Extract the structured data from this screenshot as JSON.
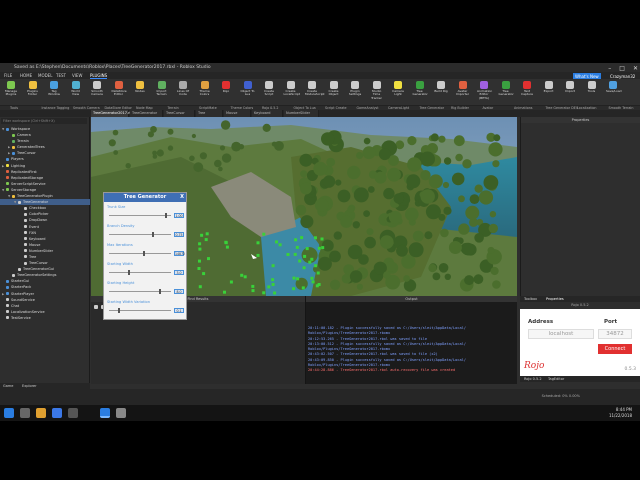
{
  "window": {
    "title": "Saved as E:\\Stephen\\Documents\\Roblox\\Places\\TreeGenerator2017.rbxl - Roblox Studio",
    "center_title": "TreeGenerator2017.rbxl - Roblox Studio"
  },
  "menubar": {
    "items": [
      "FILE",
      "HOME",
      "MODEL",
      "TEST",
      "VIEW",
      "PLUGINS"
    ],
    "active": "PLUGINS",
    "account_button": "What's New",
    "user": "Crazyman32"
  },
  "ribbon": {
    "buttons": [
      {
        "label": "Manage Plugins",
        "icon": "puzzle-icon",
        "color": "#7ec850"
      },
      {
        "label": "Plugins Folder",
        "icon": "folder-icon",
        "color": "#f0c040"
      },
      {
        "label": "Tag Window",
        "icon": "tag-icon",
        "color": "#4aa0e0"
      },
      {
        "label": "World View",
        "icon": "globe-icon",
        "color": "#50b0d0"
      },
      {
        "label": "Smooth Camera",
        "icon": "camera-icon",
        "color": "#cccccc"
      },
      {
        "label": "DataStore Editor",
        "icon": "database-icon",
        "color": "#e06040"
      },
      {
        "label": "Nodes",
        "icon": "nodes-icon",
        "color": "#f0c040"
      },
      {
        "label": "Import Terrain",
        "icon": "terrain-icon",
        "color": "#60b060"
      },
      {
        "label": "Lines Of Code",
        "icon": "code-icon",
        "color": "#aaaaaa"
      },
      {
        "label": "Theme Colors",
        "icon": "palette-icon",
        "color": "#e0a040"
      },
      {
        "label": "Rojo",
        "icon": "rojo-icon",
        "color": "#e13030"
      },
      {
        "label": "Object To Lua",
        "icon": "lua-icon",
        "color": "#4060d0"
      },
      {
        "label": "Create Script",
        "icon": "script-icon",
        "color": "#cccccc"
      },
      {
        "label": "Create LocalScript",
        "icon": "localscript-icon",
        "color": "#cccccc"
      },
      {
        "label": "Create ModuleScript",
        "icon": "modulescript-icon",
        "color": "#cccccc"
      },
      {
        "label": "Create Object",
        "icon": "object-icon",
        "color": "#cccccc"
      },
      {
        "label": "Plugin Settings",
        "icon": "settings-icon",
        "color": "#cccccc"
      },
      {
        "label": "Studio Time Tracker",
        "icon": "clock-icon",
        "color": "#cccccc"
      },
      {
        "label": "Camera Light",
        "icon": "bulb-icon",
        "color": "#f0e040"
      },
      {
        "label": "Tree Generator",
        "icon": "tree-icon",
        "color": "#3aa040"
      },
      {
        "label": "Build Rig",
        "icon": "rig-icon",
        "color": "#cccccc"
      },
      {
        "label": "Avatar Importer",
        "icon": "avatar-icon",
        "color": "#e06040"
      },
      {
        "label": "Animation Editor (BETA)",
        "icon": "animation-icon",
        "color": "#a060e0"
      },
      {
        "label": "Tree Generator",
        "icon": "tree-icon",
        "color": "#3aa040"
      },
      {
        "label": "Text Capture",
        "icon": "capture-icon",
        "color": "#e13030"
      },
      {
        "label": "Export",
        "icon": "export-icon",
        "color": "#cccccc"
      },
      {
        "label": "Import",
        "icon": "import-icon",
        "color": "#cccccc"
      },
      {
        "label": "Tools",
        "icon": "tools-icon",
        "color": "#cccccc"
      },
      {
        "label": "Save/Load",
        "icon": "save-icon",
        "color": "#50a0e0"
      }
    ],
    "groups": [
      "Tools",
      "Instance Tagging",
      "Smooth Camera",
      "DataStore Editor",
      "Node Map",
      "Terrain",
      "ScriptMate",
      "Theme Colors",
      "Rojo 0.5.2",
      "Object To Lua",
      "Script Create",
      "GameAnalyst",
      "CameraLight",
      "Tree Generator",
      "Rig Builder",
      "Avatar",
      "Animations",
      "Tree Generator DEV",
      "Localization",
      "Smooth Terrain"
    ]
  },
  "doc_tabs": [
    {
      "label": "TreeGenerator2017.rbxl",
      "active": true
    },
    {
      "label": "TreeGenerator",
      "active": false
    },
    {
      "label": "TreeCursor",
      "active": false
    },
    {
      "label": "Tree",
      "active": false
    },
    {
      "label": "Mouse",
      "active": false
    },
    {
      "label": "Keyboard",
      "active": false
    },
    {
      "label": "NumberSlider",
      "active": false
    }
  ],
  "explorer": {
    "header": "Explorer",
    "filter_placeholder": "Filter workspace (Ctrl+Shift+X)",
    "nodes": [
      {
        "label": "Workspace",
        "indent": 0,
        "arrow": "▼",
        "color": "#4a90d9"
      },
      {
        "label": "Camera",
        "indent": 1,
        "arrow": "",
        "color": "#7ec850"
      },
      {
        "label": "Terrain",
        "indent": 1,
        "arrow": "",
        "color": "#60b060"
      },
      {
        "label": "GeneratedTrees",
        "indent": 1,
        "arrow": "▶",
        "color": "#f0c040"
      },
      {
        "label": "TreeCursor",
        "indent": 1,
        "arrow": "▶",
        "color": "#4a90d9"
      },
      {
        "label": "Players",
        "indent": 0,
        "arrow": "",
        "color": "#4a90d9"
      },
      {
        "label": "Lighting",
        "indent": 0,
        "arrow": "▶",
        "color": "#f0e040"
      },
      {
        "label": "ReplicatedFirst",
        "indent": 0,
        "arrow": "",
        "color": "#e06040"
      },
      {
        "label": "ReplicatedStorage",
        "indent": 0,
        "arrow": "",
        "color": "#e06040"
      },
      {
        "label": "ServerScriptService",
        "indent": 0,
        "arrow": "",
        "color": "#7ec850"
      },
      {
        "label": "ServerStorage",
        "indent": 0,
        "arrow": "▼",
        "color": "#7ec850"
      },
      {
        "label": "TreeGeneratorPlugin",
        "indent": 1,
        "arrow": "▼",
        "color": "#f0c040"
      },
      {
        "label": "TreeGenerator",
        "indent": 2,
        "arrow": "▼",
        "color": "#cccccc",
        "selected": true
      },
      {
        "label": "Checkbox",
        "indent": 3,
        "arrow": "",
        "color": "#cccccc"
      },
      {
        "label": "ColorPicker",
        "indent": 3,
        "arrow": "",
        "color": "#cccccc"
      },
      {
        "label": "DropDown",
        "indent": 3,
        "arrow": "",
        "color": "#cccccc"
      },
      {
        "label": "Event",
        "indent": 3,
        "arrow": "",
        "color": "#cccccc"
      },
      {
        "label": "FXN",
        "indent": 3,
        "arrow": "",
        "color": "#cccccc"
      },
      {
        "label": "Keyboard",
        "indent": 3,
        "arrow": "",
        "color": "#cccccc"
      },
      {
        "label": "Mouse",
        "indent": 3,
        "arrow": "",
        "color": "#cccccc"
      },
      {
        "label": "NumberSlider",
        "indent": 3,
        "arrow": "",
        "color": "#cccccc"
      },
      {
        "label": "Tree",
        "indent": 3,
        "arrow": "",
        "color": "#cccccc"
      },
      {
        "label": "TreeCursor",
        "indent": 3,
        "arrow": "",
        "color": "#cccccc"
      },
      {
        "label": "TreeGeneratorGui",
        "indent": 2,
        "arrow": "",
        "color": "#cccccc"
      },
      {
        "label": "TreeGeneratorSettings",
        "indent": 1,
        "arrow": "",
        "color": "#cccccc"
      },
      {
        "label": "StarterGui",
        "indent": 0,
        "arrow": "",
        "color": "#4a90d9"
      },
      {
        "label": "StarterPack",
        "indent": 0,
        "arrow": "",
        "color": "#4a90d9"
      },
      {
        "label": "StarterPlayer",
        "indent": 0,
        "arrow": "▶",
        "color": "#4a90d9"
      },
      {
        "label": "SoundService",
        "indent": 0,
        "arrow": "",
        "color": "#cccccc"
      },
      {
        "label": "Chat",
        "indent": 0,
        "arrow": "",
        "color": "#cccccc"
      },
      {
        "label": "LocalizationService",
        "indent": 0,
        "arrow": "",
        "color": "#cccccc"
      },
      {
        "label": "TestService",
        "indent": 0,
        "arrow": "",
        "color": "#cccccc"
      }
    ],
    "bottom_tabs": [
      "Game",
      "Explorer"
    ]
  },
  "tree_generator": {
    "title": "Tree Generator",
    "close": "X",
    "fields": [
      {
        "label": "Trunk Size",
        "value": "1.00",
        "fraction": 0.9
      },
      {
        "label": "Branch Density",
        "value": "0.75",
        "fraction": 0.7
      },
      {
        "label": "Max Iterations",
        "value": "14872",
        "fraction": 0.55
      },
      {
        "label": "Starting Width",
        "value": "3.0",
        "fraction": 0.3
      },
      {
        "label": "Starting Height",
        "value": "8.0",
        "fraction": 0.8
      },
      {
        "label": "Starting Width Variation",
        "value": "0.1",
        "fraction": 0.15
      }
    ]
  },
  "panels": {
    "find_results": "Find Results",
    "output": "Output",
    "properties_tab": "Properties",
    "toolbox_tab": "Toolbox"
  },
  "output_lines": [
    {
      "text": "20:11:00.182 - Plugin successfully saved as C:/Users/sleit/AppData/Local/",
      "color": "blue"
    },
    {
      "text": "Roblox/Plugins/TreeGenerator2017.rbxmx",
      "color": "blue"
    },
    {
      "text": "20:12:53.265 - TreeGenerator2017.rbxl was saved to file",
      "color": "blue"
    },
    {
      "text": "20:13:00.512 - Plugin successfully saved as C:/Users/sleit/AppData/Local/",
      "color": "blue"
    },
    {
      "text": "Roblox/Plugins/TreeGenerator2017.rbxmx",
      "color": "blue"
    },
    {
      "text": "20:43:02.507 - TreeGenerator2017.rbxl was saved to file (x2)",
      "color": "blue"
    },
    {
      "text": "20:43:09.850 - Plugin successfully saved as C:/Users/sleit/AppData/Local/",
      "color": "blue"
    },
    {
      "text": "Roblox/Plugins/TreeGenerator2017.rbxmx",
      "color": "blue"
    },
    {
      "text": "20:44:28.886 - TreeGenerator2017.rbxl auto-recovery file was created",
      "color": "red"
    }
  ],
  "rojo": {
    "panel_title": "Rojo 0.5.2",
    "address_label": "Address",
    "port_label": "Port",
    "address_placeholder": "localhost",
    "port_placeholder": "34872",
    "connect": "Connect",
    "logo": "Rojo",
    "version": "0.5.3",
    "footer_tabs": [
      "Rojo 0.5.2",
      "TagEditor"
    ]
  },
  "statusbar": {
    "left": "",
    "right": "Scheduled: 0%  0.00%"
  },
  "taskbar": {
    "time": "8:44 PM",
    "date": "11/22/2018"
  }
}
